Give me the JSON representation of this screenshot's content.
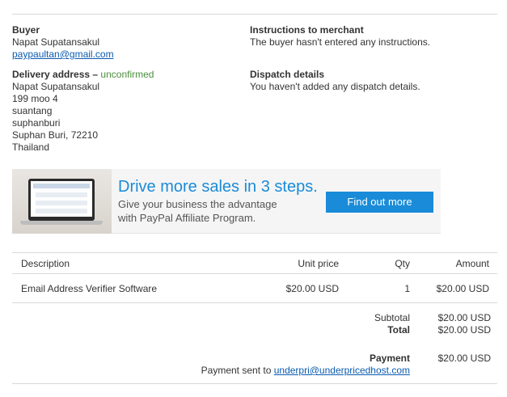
{
  "buyer": {
    "heading": "Buyer",
    "name": "Napat Supatansakul",
    "email": "paypaultan@gmail.com"
  },
  "delivery": {
    "heading": "Delivery address –",
    "status": "unconfirmed",
    "lines": [
      "Napat Supatansakul",
      "199 moo 4",
      "suantang",
      "suphanburi",
      "Suphan Buri, 72210",
      "Thailand"
    ]
  },
  "instructions": {
    "heading": "Instructions to merchant",
    "text": "The buyer hasn't entered any instructions."
  },
  "dispatch": {
    "heading": "Dispatch details",
    "text": "You haven't added any dispatch details."
  },
  "banner": {
    "headline": "Drive more sales in 3 steps.",
    "line1": "Give your business the advantage",
    "line2": "with PayPal Affiliate Program.",
    "button_label": "Find out more"
  },
  "table": {
    "headers": {
      "description": "Description",
      "unit_price": "Unit price",
      "qty": "Qty",
      "amount": "Amount"
    },
    "rows": [
      {
        "description": "Email Address Verifier Software",
        "unit_price": "$20.00 USD",
        "qty": "1",
        "amount": "$20.00 USD"
      }
    ]
  },
  "totals": {
    "subtotal_label": "Subtotal",
    "subtotal_value": "$20.00 USD",
    "total_label": "Total",
    "total_value": "$20.00 USD",
    "payment_label": "Payment",
    "payment_value": "$20.00 USD",
    "payment_sent_prefix": "Payment sent to",
    "payment_sent_email": "underpri@underpricedhost.com"
  }
}
